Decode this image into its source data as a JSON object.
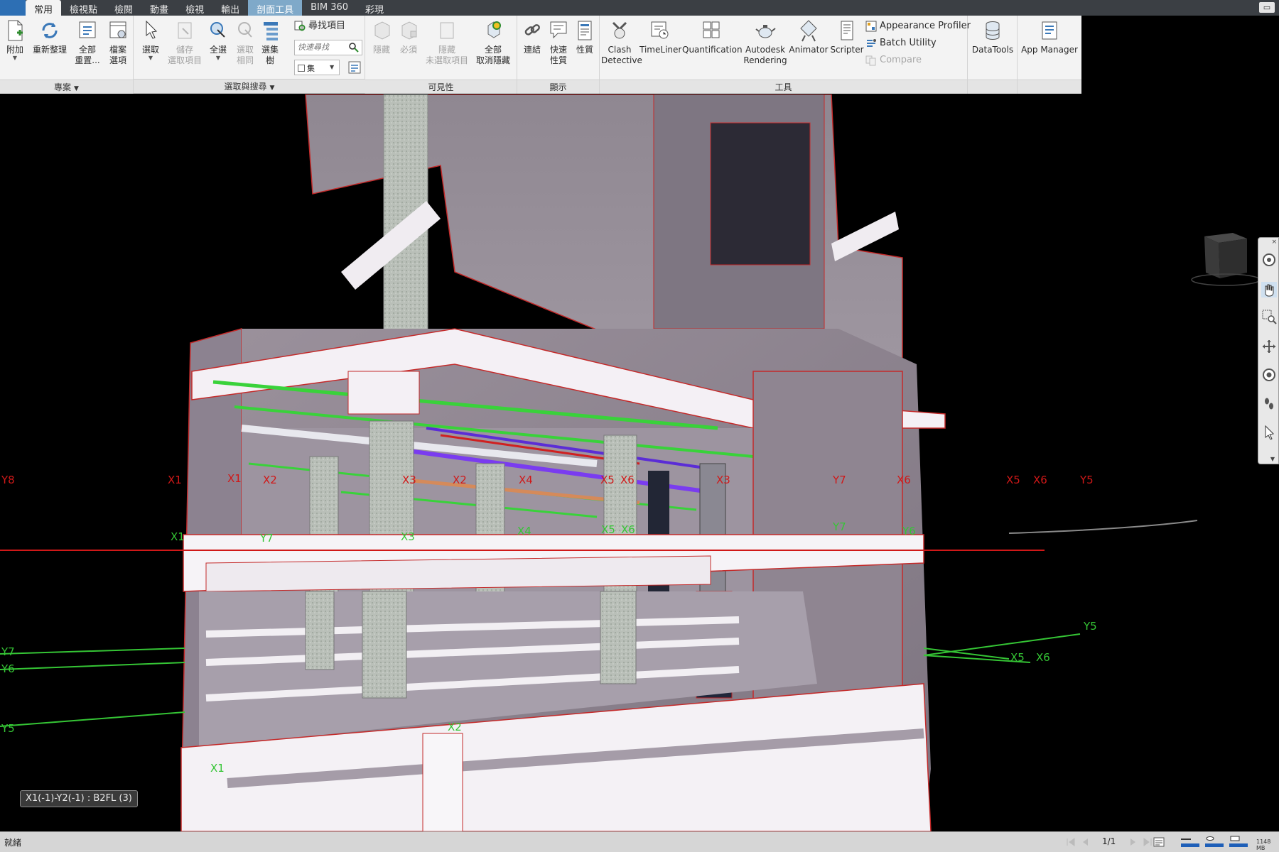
{
  "tabs": [
    {
      "label": "常用",
      "state": "active"
    },
    {
      "label": "檢視點",
      "state": "normal"
    },
    {
      "label": "檢閱",
      "state": "normal"
    },
    {
      "label": "動畫",
      "state": "normal"
    },
    {
      "label": "檢視",
      "state": "normal"
    },
    {
      "label": "輸出",
      "state": "normal"
    },
    {
      "label": "剖面工具",
      "state": "highlight"
    },
    {
      "label": "BIM 360",
      "state": "normal"
    },
    {
      "label": "彩現",
      "state": "normal"
    }
  ],
  "ribbon": {
    "project": {
      "title": "專案",
      "append": "附加",
      "refresh": "重新整理",
      "reset_all": [
        "全部",
        "重置..."
      ],
      "file_options": [
        "檔案",
        "選項"
      ]
    },
    "select_search": {
      "title": "選取與搜尋",
      "select": "選取",
      "save_selection": [
        "儲存",
        "選取項目"
      ],
      "select_all": "全選",
      "select_same": [
        "選取",
        "相同"
      ],
      "selection_tree": [
        "選集",
        "樹"
      ],
      "find_items": "尋找項目",
      "quick_find_placeholder": "快速尋找",
      "sets_value": "集"
    },
    "visibility": {
      "title": "可見性",
      "hide": "隱藏",
      "require": "必須",
      "hide_unselected": [
        "隱藏",
        "未選取項目"
      ],
      "unhide_all": [
        "全部",
        "取消隱藏"
      ]
    },
    "display": {
      "title": "顯示",
      "links": "連結",
      "quick_properties": [
        "快速",
        "性質"
      ],
      "properties": "性質"
    },
    "tools": {
      "title": "工具",
      "clash_detective": [
        "Clash",
        "Detective"
      ],
      "timeliner": "TimeLiner",
      "quantification": "Quantification",
      "autodesk_rendering": [
        "Autodesk",
        "Rendering"
      ],
      "animator": "Animator",
      "scripter": "Scripter",
      "appearance_profiler": "Appearance Profiler",
      "batch_utility": "Batch Utility",
      "compare": "Compare",
      "datatools": "DataTools",
      "app_manager": "App Manager"
    }
  },
  "grid_labels": {
    "red": [
      "Y8",
      "X1",
      "X1",
      "X2",
      "X3",
      "X2",
      "X4",
      "X5",
      "X6",
      "X3",
      "Y7",
      "X6",
      "X5",
      "X6",
      "Y5"
    ],
    "green": [
      "X1",
      "Y7",
      "X3",
      "X4",
      "X5",
      "X6",
      "Y7",
      "Y6",
      "Y5",
      "X5",
      "X6",
      "Y7",
      "Y6",
      "Y5",
      "X2",
      "X1"
    ]
  },
  "location_tooltip": "X1(-1)-Y2(-1) : B2FL (3)",
  "status": {
    "text": "就緒",
    "page": "1/1",
    "memory": "1148 MB"
  },
  "colors": {
    "tab_active": "#f3f3f3",
    "tab_highlight": "#7fa9c9",
    "grid_red": "#d01818",
    "grid_green": "#35c535",
    "wall": "#8f8590",
    "slab": "#f2eef3",
    "edge": "#c42a2a"
  }
}
